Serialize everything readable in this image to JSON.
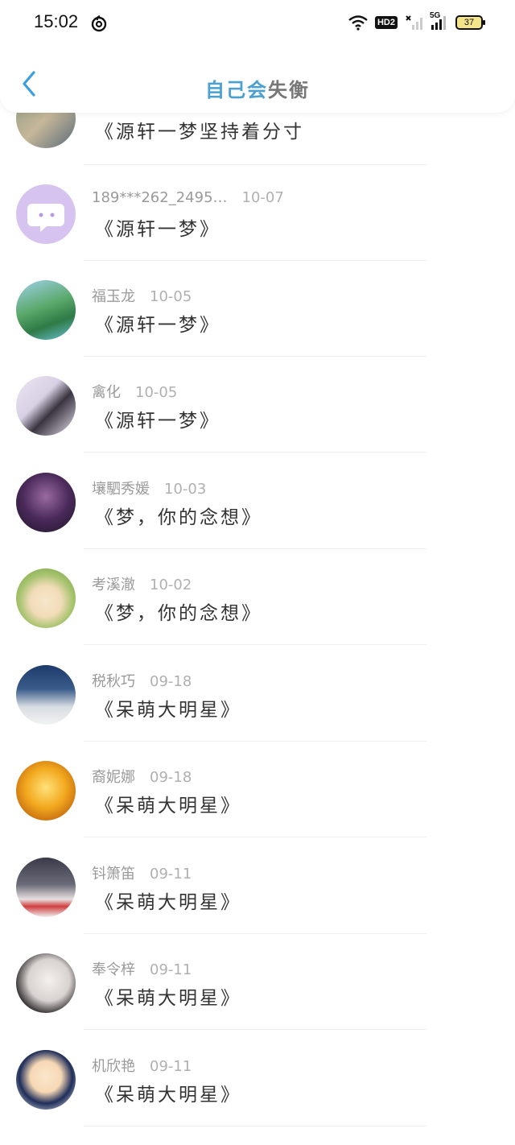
{
  "status_bar": {
    "time": "15:02",
    "network_type": "HD2",
    "signal_label": "5G",
    "battery": "37"
  },
  "nav": {
    "title_part1": "自己会",
    "title_part2": "失衡"
  },
  "comments": [
    {
      "name": "",
      "date": "",
      "text": "《源轩一梦坚持着分寸"
    },
    {
      "name": "189***262_2495…",
      "date": "10-07",
      "text": "《源轩一梦》"
    },
    {
      "name": "福玉龙",
      "date": "10-05",
      "text": "《源轩一梦》"
    },
    {
      "name": "禽化",
      "date": "10-05",
      "text": "《源轩一梦》"
    },
    {
      "name": "壤駟秀媛",
      "date": "10-03",
      "text": "《梦，你的念想》"
    },
    {
      "name": "考溪澈",
      "date": "10-02",
      "text": "《梦，你的念想》"
    },
    {
      "name": "税秋巧",
      "date": "09-18",
      "text": "《呆萌大明星》"
    },
    {
      "name": "裔妮娜",
      "date": "09-18",
      "text": "《呆萌大明星》"
    },
    {
      "name": "钭箫笛",
      "date": "09-11",
      "text": "《呆萌大明星》"
    },
    {
      "name": "奉令梓",
      "date": "09-11",
      "text": "《呆萌大明星》"
    },
    {
      "name": "机欣艳",
      "date": "09-11",
      "text": "《呆萌大明星》"
    }
  ]
}
